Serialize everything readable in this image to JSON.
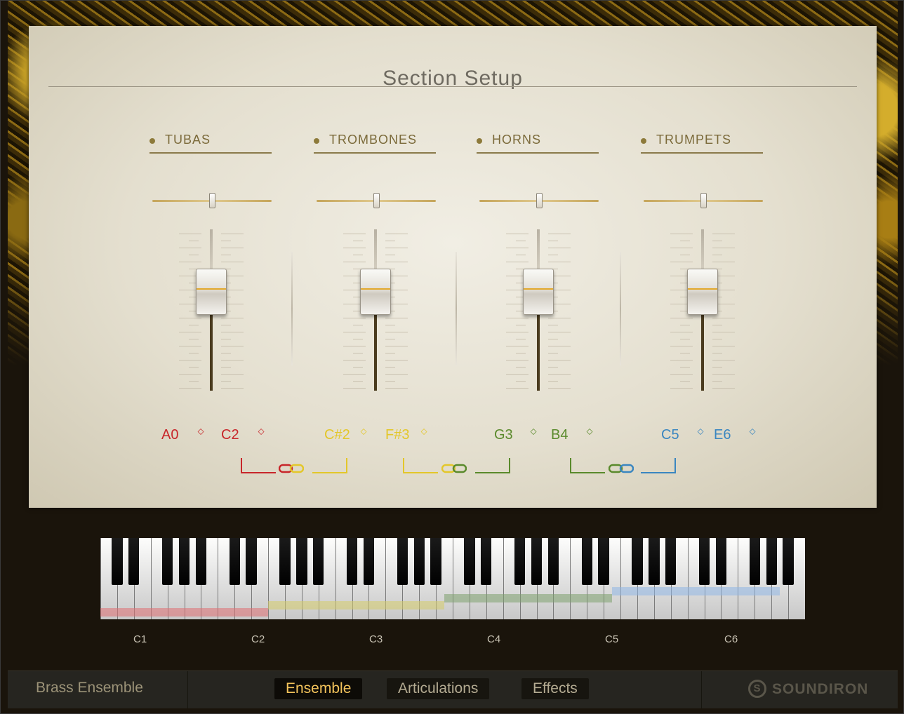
{
  "panel": {
    "title": "Section Setup"
  },
  "sections": [
    {
      "name": "TUBAS",
      "low": "A0",
      "high": "C2",
      "color": "#c8262a",
      "pan": 0.5,
      "level": 0.5
    },
    {
      "name": "TROMBONES",
      "low": "C#2",
      "high": "F#3",
      "color": "#e3c72a",
      "pan": 0.5,
      "level": 0.5
    },
    {
      "name": "HORNS",
      "low": "G3",
      "high": "B4",
      "color": "#5a8a2c",
      "pan": 0.5,
      "level": 0.5
    },
    {
      "name": "TRUMPETS",
      "low": "C5",
      "high": "E6",
      "color": "#3a86c0",
      "pan": 0.5,
      "level": 0.5
    }
  ],
  "keyboard": {
    "octave_labels": [
      "C1",
      "C2",
      "C3",
      "C4",
      "C5",
      "C6"
    ],
    "range_colors": [
      "#e06f73",
      "#d6cc6a",
      "#7ea06e",
      "#8fb6e6"
    ]
  },
  "footer": {
    "instrument": "Brass Ensemble",
    "tabs": [
      "Ensemble",
      "Articulations",
      "Effects"
    ],
    "active_tab": "Ensemble",
    "brand": "SOUNDIRON"
  },
  "icons": {
    "link": "chain-link-icon",
    "spinner": "up-down-arrow-icon",
    "logo": "soundiron-logo-icon"
  }
}
